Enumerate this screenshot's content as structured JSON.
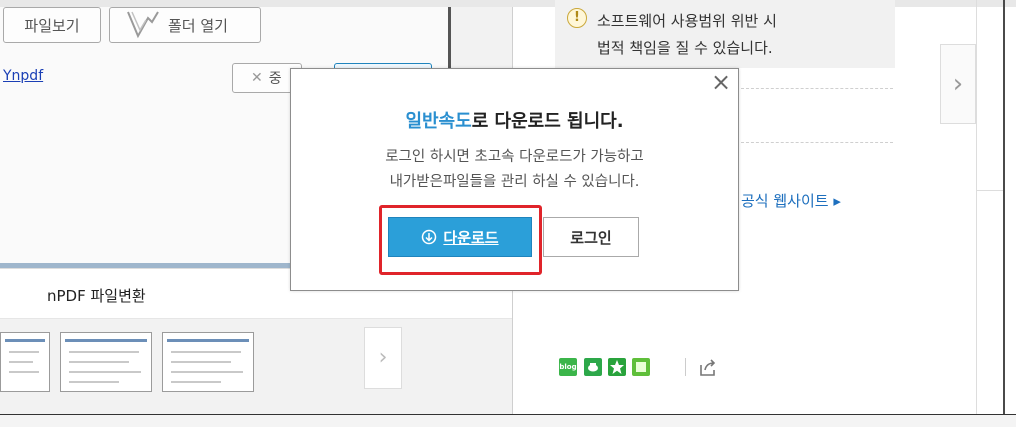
{
  "left_panel": {
    "file_view_button": "파일보기",
    "open_folder_button": "폴더 열기",
    "path_link": "Ynpdf",
    "partial_button_text": "중",
    "product_title": "nPDF 파일변환"
  },
  "right_panel": {
    "notice_icon": "!",
    "notice_lines": [
      "소프트웨어 사용범위 위반 시",
      "법적 책임을 질 수 있습니다."
    ],
    "official_site_link": "공식 웹사이트 ▸"
  },
  "modal": {
    "title_highlight": "일반속도",
    "title_rest": "로 다운로드 됩니다.",
    "description_lines": [
      "로그인 하시면 초고속 다운로드가 가능하고",
      "내가받은파일들을 관리 하실 수 있습니다."
    ],
    "download_button": "다운로드",
    "login_button": "로그인"
  },
  "social": {
    "blog_label": "blog"
  },
  "colors": {
    "accent_blue": "#2b9fd9",
    "highlight_red": "#e0242a",
    "link_blue": "#1d6fbe"
  }
}
